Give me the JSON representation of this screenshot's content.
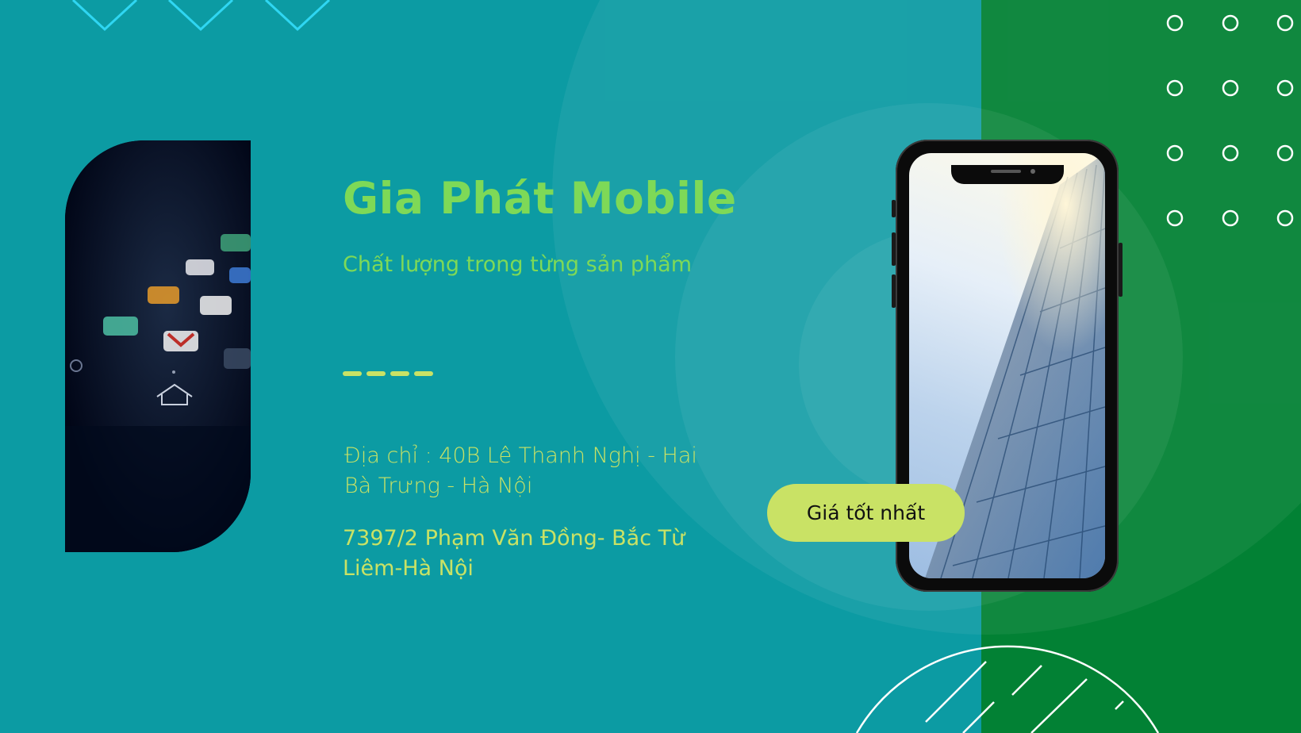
{
  "slide": {
    "title": "Gia Phát Mobile",
    "tagline": "Chất lượng trong từng sản phẩm",
    "address_line": "Địa chỉ : 40B Lê Thanh Nghị - Hai Bà Trưng - Hà Nội",
    "address_line_2": "7397/2 Phạm Văn Đồng- Bắc Từ Liêm-Hà Nội",
    "price_button_label": "Giá tốt nhất"
  },
  "colors": {
    "background": "#0c9ba3",
    "green_panel": "#028134",
    "title_green": "#7ed957",
    "lime": "#c9e265",
    "chevron_cyan": "#2fd6f2"
  },
  "icons": [
    "chevron-down-icon",
    "circle-outline-icon",
    "home-icon",
    "gmail-icon"
  ]
}
